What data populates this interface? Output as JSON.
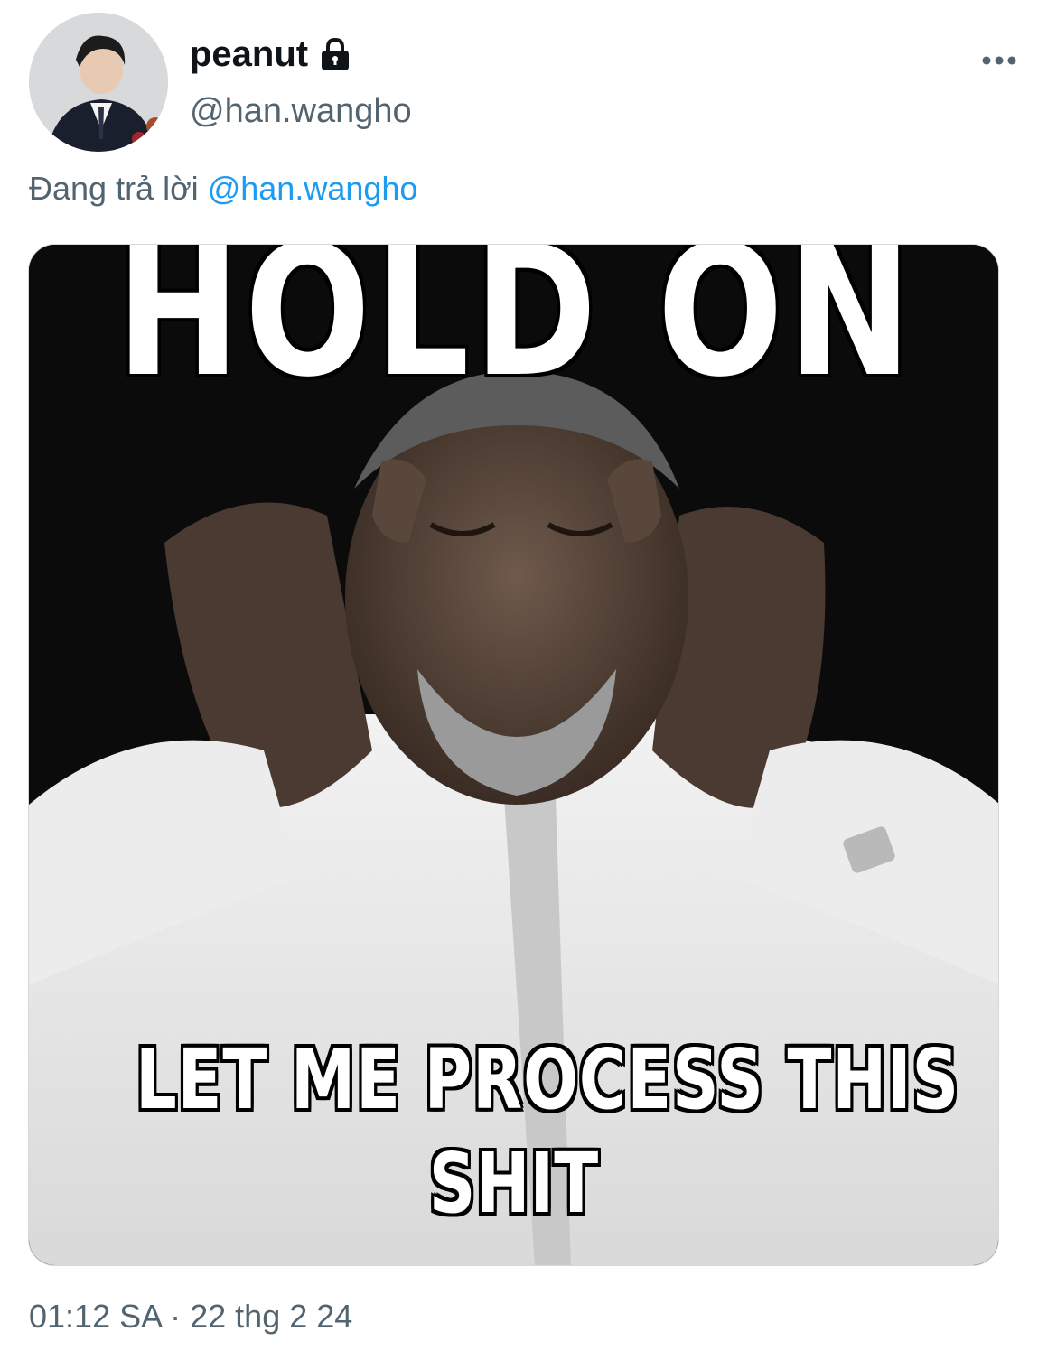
{
  "tweet": {
    "display_name": "peanut",
    "handle": "@han.wangho",
    "reply_prefix": "Đang trả lời",
    "reply_to": "@han.wangho",
    "timestamp": "01:12 SA · 22 thg 2 24"
  },
  "media": {
    "top_text": "HOLD ON",
    "bottom_text_line1": "LET ME PROCESS THIS",
    "bottom_text_line2": "SHIT"
  },
  "icons": {
    "lock": "lock-icon",
    "more": "more-options-icon"
  },
  "colors": {
    "text_primary": "#0f1419",
    "text_secondary": "#536471",
    "link": "#1d9bf0"
  }
}
